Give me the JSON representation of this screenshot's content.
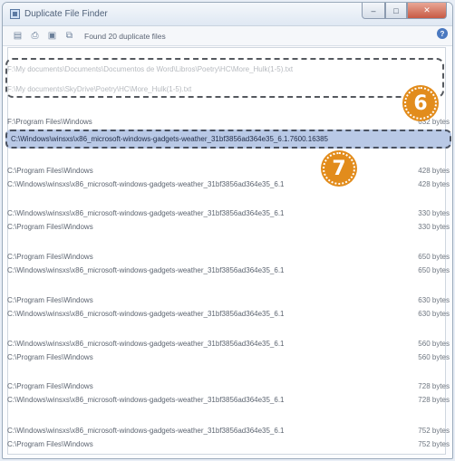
{
  "window": {
    "title": "Duplicate File Finder",
    "controls": {
      "min": "–",
      "max": "□",
      "close": "✕"
    }
  },
  "toolbar": {
    "found_text": "Found 20 duplicate files",
    "icons": [
      "view-icon",
      "print-icon",
      "save-icon",
      "copy-icon"
    ]
  },
  "rows": [
    {
      "path": "F:\\My documents\\Documents\\Documentos de Word\\Libros\\Poetry\\HC\\More_Hulk(1-5).txt",
      "size": ""
    },
    {
      "path": "F:\\My documents\\SkyDrive\\Poetry\\HC\\More_Hulk(1-5).txt",
      "size": ""
    },
    {
      "path": "F:\\Program Files\\Windows",
      "size": "632 bytes"
    },
    {
      "path": "C:\\Windows\\winsxs\\x86_microsoft-windows-gadgets-weather_31bf3856ad364e35",
      "size": ""
    },
    {
      "path": "C:\\Program Files\\Windows",
      "size": "428 bytes"
    },
    {
      "path": "C:\\Windows\\winsxs\\x86_microsoft-windows-gadgets-weather_31bf3856ad364e35_6.1",
      "size": "428 bytes"
    },
    {
      "path": "C:\\Windows\\winsxs\\x86_microsoft-windows-gadgets-weather_31bf3856ad364e35_6.1",
      "size": "330 bytes"
    },
    {
      "path": "C:\\Program Files\\Windows",
      "size": "330 bytes"
    },
    {
      "path": "C:\\Program Files\\Windows",
      "size": "650 bytes"
    },
    {
      "path": "C:\\Windows\\winsxs\\x86_microsoft-windows-gadgets-weather_31bf3856ad364e35_6.1",
      "size": "650 bytes"
    },
    {
      "path": "C:\\Program Files\\Windows",
      "size": "630 bytes"
    },
    {
      "path": "C:\\Windows\\winsxs\\x86_microsoft-windows-gadgets-weather_31bf3856ad364e35_6.1",
      "size": "630 bytes"
    },
    {
      "path": "C:\\Windows\\winsxs\\x86_microsoft-windows-gadgets-weather_31bf3856ad364e35_6.1",
      "size": "560 bytes"
    },
    {
      "path": "C:\\Program Files\\Windows",
      "size": "560 bytes"
    },
    {
      "path": "C:\\Program Files\\Windows",
      "size": "728 bytes"
    },
    {
      "path": "C:\\Windows\\winsxs\\x86_microsoft-windows-gadgets-weather_31bf3856ad364e35_6.1",
      "size": "728 bytes"
    },
    {
      "path": "C:\\Windows\\winsxs\\x86_microsoft-windows-gadgets-weather_31bf3856ad364e35_6.1",
      "size": "752 bytes"
    },
    {
      "path": "C:\\Program Files\\Windows",
      "size": "752 bytes"
    }
  ],
  "selected_row": "C:\\Windows\\winsxs\\x86_microsoft-windows-gadgets-weather_31bf3856ad364e35_6.1.7600.16385",
  "callouts": {
    "six": "6",
    "seven": "7",
    "color": "#e28c1c"
  }
}
